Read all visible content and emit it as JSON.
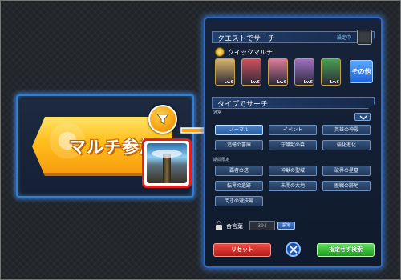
{
  "banner": {
    "join_label": "マルチ参加"
  },
  "panel": {
    "quest_search": {
      "title": "クエストでサーチ",
      "setting_status": "設定中"
    },
    "quick_multi": {
      "label": "クイックマルチ",
      "characters": [
        {
          "level": "Lv.6",
          "color": "#d9b46a"
        },
        {
          "level": "Lv.6",
          "color": "#d0505a"
        },
        {
          "level": "Lv.6",
          "color": "#e07a9a"
        },
        {
          "level": "Lv.6",
          "color": "#a070c0"
        },
        {
          "level": "Lv.6",
          "color": "#4aa050"
        }
      ],
      "other_label": "その他"
    },
    "type_search": {
      "title": "タイプでサーチ",
      "normal_label": "通常",
      "normal_buttons": [
        "ノーマル",
        "イベント",
        "英雄の神殿",
        "追憶の書庫",
        "守護獣の森",
        "強化進化"
      ],
      "selected_index": 0,
      "limited_label": "期間限定",
      "limited_buttons": [
        "覇者の塔",
        "神獣の聖域",
        "破界の星墓",
        "転界の遺跡",
        "未開の大地",
        "歴戦の跡地",
        "閃きの遊技場"
      ]
    },
    "password": {
      "label": "合言葉",
      "value": "394",
      "set_label": "設定"
    },
    "reset_label": "リセット",
    "search_label": "指定せず検索"
  }
}
